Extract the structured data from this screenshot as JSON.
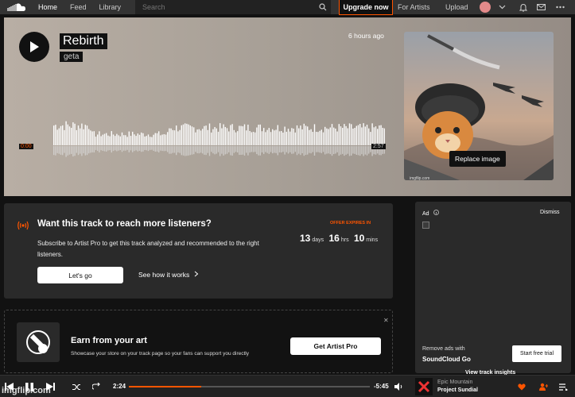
{
  "nav": {
    "links": [
      "Home",
      "Feed",
      "Library"
    ],
    "search_placeholder": "Search",
    "upgrade": "Upgrade now",
    "for_artists": "For Artists",
    "upload": "Upload"
  },
  "track": {
    "title": "Rebirth",
    "artist": "geta",
    "posted": "6 hours ago",
    "time_current": "0:00",
    "time_total": "2:57",
    "replace_image": "Replace image",
    "cover_credit": "imgflip.com"
  },
  "promo": {
    "title": "Want this track to reach more listeners?",
    "description": "Subscribe to Artist Pro to get this track analyzed and recommended to the right listeners.",
    "offer_label": "OFFER EXPIRES IN",
    "days": "13",
    "days_unit": "days",
    "hours": "16",
    "hours_unit": "hrs",
    "mins": "10",
    "mins_unit": "mins",
    "cta": "Let's go",
    "secondary": "See how it works"
  },
  "earn": {
    "title": "Earn from your art",
    "description": "Showcase your store on your track page so your fans can support you directly",
    "cta": "Get Artist Pro"
  },
  "ad": {
    "label": "Ad",
    "dismiss": "Dismiss",
    "remove_text": "Remove ads with",
    "brand": "SoundCloud Go",
    "trial": "Start free trial"
  },
  "view_insights": "View track insights",
  "player": {
    "current": "2:24",
    "remaining": "-5:45",
    "progress": 0.3,
    "artist": "Epic Mountain",
    "track": "Project Sundial"
  },
  "watermark": "imgflip.com",
  "colors": {
    "accent": "#ff5500",
    "background": "#121212",
    "card": "#2a2a2a"
  }
}
